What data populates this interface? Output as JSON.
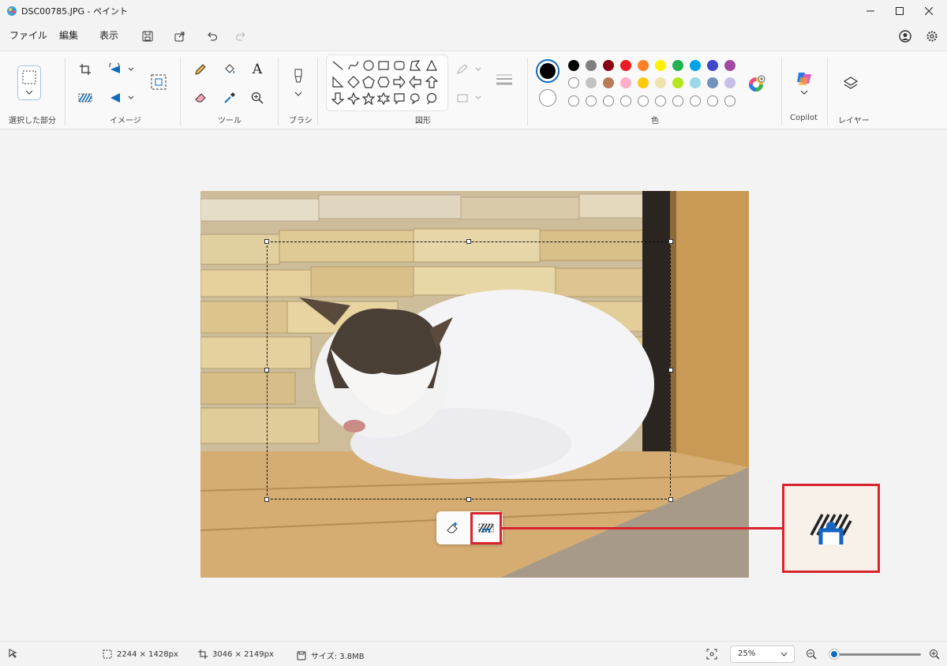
{
  "window": {
    "title": "DSC00785.JPG - ペイント",
    "minimize": "—",
    "maximize": "☐",
    "close": "✕"
  },
  "menu": {
    "items": [
      "ファイル",
      "編集",
      "表示"
    ]
  },
  "ribbon": {
    "groups": {
      "selection": "選択した部分",
      "image": "イメージ",
      "tools": "ツール",
      "brush": "ブラシ",
      "shapes": "図形",
      "colors": "色",
      "copilot": "Copilot",
      "layers": "レイヤー"
    },
    "tools_text_glyph": "A",
    "primary_color": "#000000",
    "secondary_color": "#ffffff",
    "palette_row1": [
      "#000000",
      "#7f7f7f",
      "#880015",
      "#ed1c24",
      "#ff7f27",
      "#fff200",
      "#22b14c",
      "#00a2e8",
      "#3f48cc",
      "#a349a4"
    ],
    "palette_row2": [
      "#ffffff",
      "#c3c3c3",
      "#b97a57",
      "#ffaec9",
      "#ffc90e",
      "#efe4b0",
      "#b5e61d",
      "#99d9ea",
      "#7092be",
      "#c8bfe7"
    ]
  },
  "floating_toolbar": {
    "buttons": [
      "erase-background-icon",
      "generative-erase-icon"
    ]
  },
  "status": {
    "selection_size": "2244 × 1428px",
    "image_size": "3046 × 2149px",
    "file_size": "サイズ: 3.8MB",
    "zoom": "25%",
    "zoom_level": 0.05
  }
}
